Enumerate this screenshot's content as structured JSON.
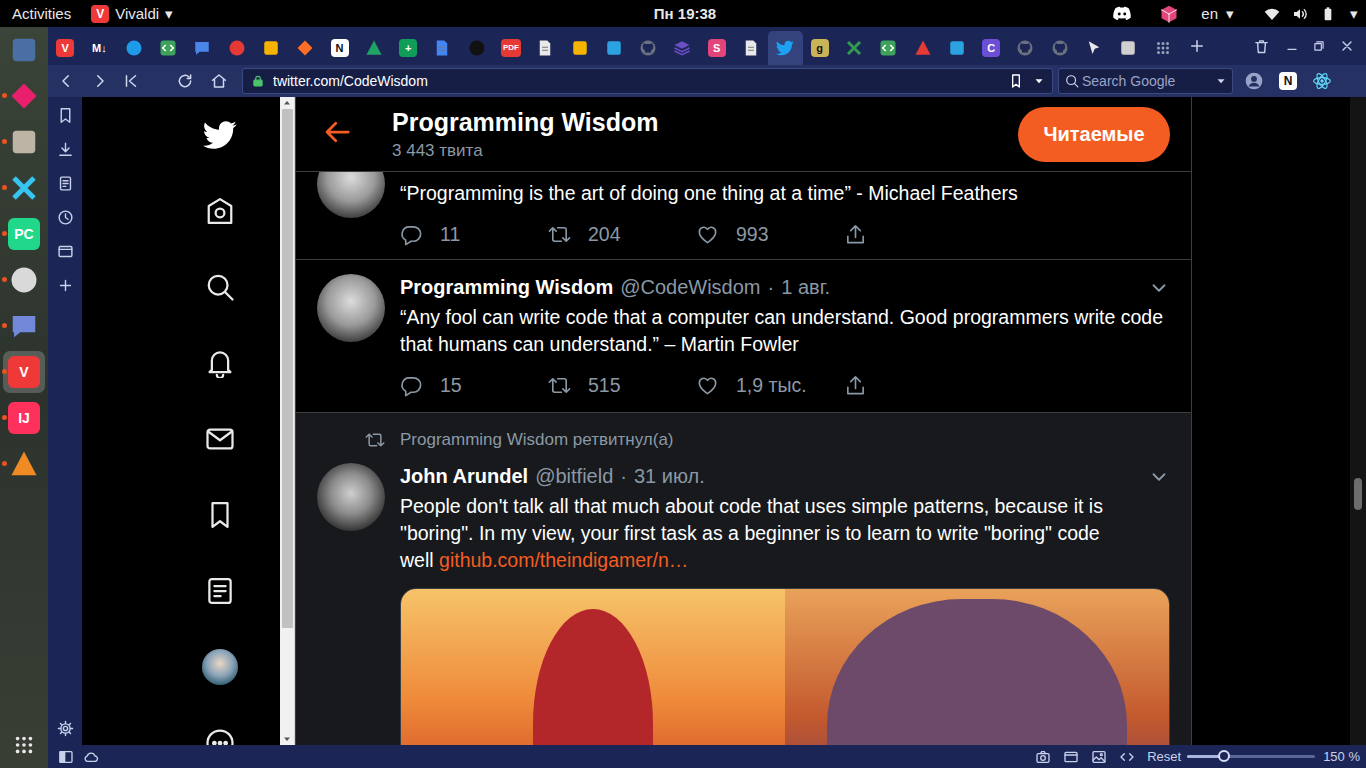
{
  "topbar": {
    "activities": "Activities",
    "app_icon": "V",
    "app": "Vivaldi",
    "app_arrow": "▾",
    "clock": "Пн 19:38",
    "lang": "en",
    "lang_arrow": "▾",
    "system_arrow": "▾"
  },
  "dock": {
    "items": [
      {
        "running": false,
        "selected": false,
        "color": "#4a6fa5"
      },
      {
        "running": true,
        "selected": false,
        "color": "#e8206c"
      },
      {
        "running": true,
        "selected": false,
        "color": "#bdb4a6"
      },
      {
        "running": true,
        "selected": false,
        "color": "#36c5f0"
      },
      {
        "running": true,
        "selected": false,
        "label": "PC",
        "color": "#21d789"
      },
      {
        "running": true,
        "selected": false,
        "color": "#d9d9d9"
      },
      {
        "running": true,
        "selected": false,
        "color": "#7289da"
      },
      {
        "running": true,
        "selected": true,
        "label": "V",
        "color": "#ef3939"
      },
      {
        "running": true,
        "selected": false,
        "label": "IJ",
        "color": "#fe315d"
      },
      {
        "running": true,
        "selected": false,
        "color": "#f08a24"
      }
    ]
  },
  "tabs": [
    {
      "color": "#ef3939",
      "selected": false,
      "glyph": "V"
    },
    {
      "color": "#1c2656",
      "selected": false,
      "glyph": "M↓"
    },
    {
      "color": "#1e9be8",
      "selected": false
    },
    {
      "color": "#3ea35a",
      "selected": false
    },
    {
      "color": "#4a86e8",
      "selected": false
    },
    {
      "color": "#e53935",
      "selected": false
    },
    {
      "color": "#f4b400",
      "selected": false
    },
    {
      "color": "#fc6d26",
      "selected": false
    },
    {
      "color": "#ffffff",
      "selected": false,
      "glyph": "N"
    },
    {
      "color": "#1fa463",
      "selected": false
    },
    {
      "color": "#0f9d58",
      "selected": false,
      "glyph": "+"
    },
    {
      "color": "#4285f4",
      "selected": false
    },
    {
      "color": "#111111",
      "selected": false
    },
    {
      "color": "#e53935",
      "selected": false,
      "glyph": "PDF"
    },
    {
      "color": "#e8e8e8",
      "selected": false
    },
    {
      "color": "#f4b400",
      "selected": false
    },
    {
      "color": "#2aa3e0",
      "selected": false
    },
    {
      "color": "#6b7080",
      "selected": false
    },
    {
      "color": "#6a4fc4",
      "selected": false
    },
    {
      "color": "#e3447a",
      "selected": false,
      "glyph": "S"
    },
    {
      "color": "#e8e8e8",
      "selected": false
    },
    {
      "color": "#1da1f2",
      "selected": true
    },
    {
      "color": "#c9b458",
      "selected": false,
      "glyph": "g"
    },
    {
      "color": "#2e9b4e",
      "selected": false
    },
    {
      "color": "#3ea35a",
      "selected": false
    },
    {
      "color": "#e53935",
      "selected": false
    },
    {
      "color": "#2aa3e0",
      "selected": false
    },
    {
      "color": "#6c4fd6",
      "selected": false,
      "glyph": "C"
    },
    {
      "color": "#6b7080",
      "selected": false
    },
    {
      "color": "#6b7080",
      "selected": false
    },
    {
      "color": "#e8e8e8",
      "selected": false
    },
    {
      "color": "#d0d0d0",
      "selected": false
    },
    {
      "color": "#9aa0b8",
      "selected": false
    }
  ],
  "addressbar": {
    "url": "twitter.com/CodeWisdom",
    "search_placeholder": "Search Google",
    "extensions": [
      {
        "color": "#9aa3c7"
      },
      {
        "glyph": "N",
        "color": "#ffffff"
      },
      {
        "color": "#61dafb"
      }
    ]
  },
  "twitter": {
    "header": {
      "name": "Programming Wisdom",
      "count": "3 443 твита",
      "button": "Читаемые"
    },
    "tweets": [
      {
        "kind": "scrolled",
        "text": "“Programming is the art of doing one thing at a time” - Michael Feathers",
        "replies": "11",
        "retweets": "204",
        "likes": "993"
      },
      {
        "kind": "tweet",
        "name": "Programming Wisdom",
        "handle": "@CodeWisdom",
        "dot": "·",
        "date": "1 авг.",
        "text": "“Any fool can write code that a computer can understand. Good programmers write code that humans can understand.” – Martin Fowler",
        "replies": "15",
        "retweets": "515",
        "likes": "1,9 тыс."
      },
      {
        "kind": "retweet",
        "retweeted_by": "Programming Wisdom ретвитнул(а)",
        "name": "John Arundel",
        "handle": "@bitfield",
        "dot": "·",
        "date": "31 июл.",
        "text": "People don't talk all that much about code that uses simple patterns, because it is \"boring\". In my view, your first task as a beginner is to learn to write \"boring\" code well",
        "link": "github.com/theindigamer/n…"
      }
    ]
  },
  "statusbar": {
    "reset": "Reset",
    "zoom": {
      "level": 0.29,
      "reading": "150 %"
    }
  }
}
